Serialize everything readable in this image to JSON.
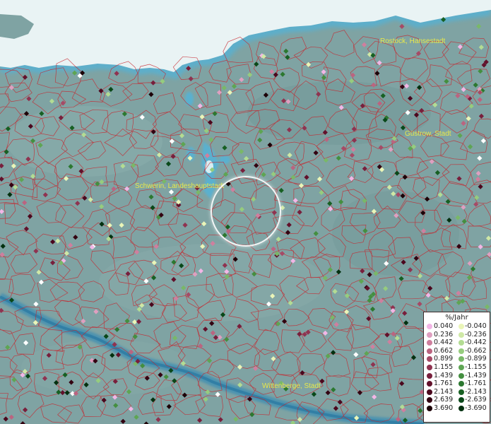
{
  "map": {
    "cities": [
      {
        "name": "Rostock, Hansestadt"
      },
      {
        "name": "Güstrow, Stadt"
      },
      {
        "name": "Schwerin, Landeshauptstadt"
      },
      {
        "name": "Wittenberge, Stadt"
      }
    ]
  },
  "legend": {
    "title": "%/Jahr",
    "rows": [
      {
        "pos": "0.040",
        "neg": "-0.040",
        "pos_color": "#f2b6e6",
        "neg_color": "#eaf5b8"
      },
      {
        "pos": "0.236",
        "neg": "-0.236",
        "pos_color": "#df9fc0",
        "neg_color": "#cfe8a6"
      },
      {
        "pos": "0.442",
        "neg": "-0.442",
        "pos_color": "#cf7f9e",
        "neg_color": "#b3dc93"
      },
      {
        "pos": "0.662",
        "neg": "-0.662",
        "pos_color": "#bb6480",
        "neg_color": "#96cc7e"
      },
      {
        "pos": "0.899",
        "neg": "-0.899",
        "pos_color": "#a64a66",
        "neg_color": "#79b868"
      },
      {
        "pos": "1.155",
        "neg": "-1.155",
        "pos_color": "#8f3350",
        "neg_color": "#5ea553"
      },
      {
        "pos": "1.439",
        "neg": "-1.439",
        "pos_color": "#781f3c",
        "neg_color": "#448f40"
      },
      {
        "pos": "1.761",
        "neg": "-1.761",
        "pos_color": "#62112b",
        "neg_color": "#2c7830"
      },
      {
        "pos": "2.143",
        "neg": "-2.143",
        "pos_color": "#4b071d",
        "neg_color": "#176023"
      },
      {
        "pos": "2.639",
        "neg": "-2.639",
        "pos_color": "#330211",
        "neg_color": "#094819"
      },
      {
        "pos": "3.690",
        "neg": "-3.690",
        "pos_color": "#1c0007",
        "neg_color": "#02300f"
      }
    ]
  },
  "colors": {
    "land": "#7fa3a3",
    "water": "#e8f3f5",
    "river": "#3f8fb3",
    "borders": "#c8222a",
    "label_text": "#e8e84a"
  }
}
